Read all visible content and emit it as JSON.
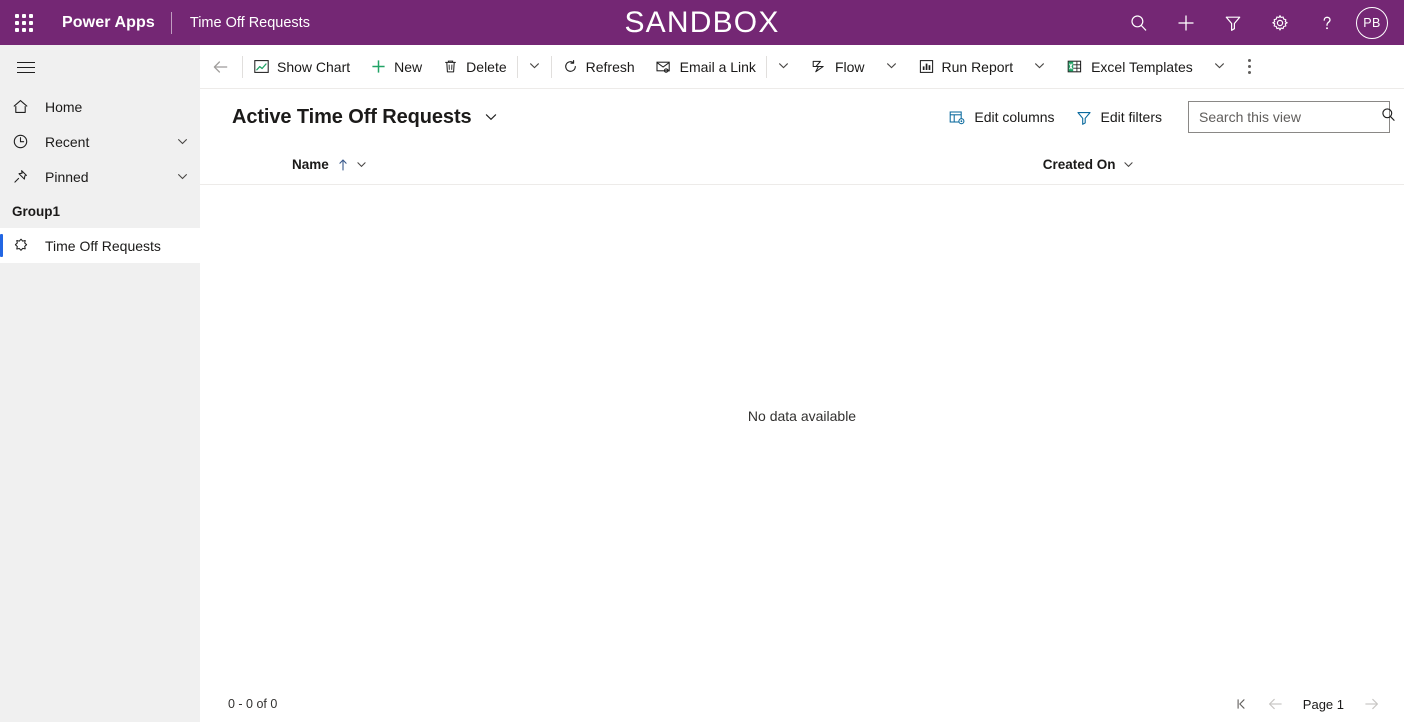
{
  "appbar": {
    "waffle_icon": "app-launcher-icon",
    "brand": "Power Apps",
    "app_name": "Time Off Requests",
    "environment": "SANDBOX",
    "actions": [
      {
        "name": "search-icon",
        "label": "Search"
      },
      {
        "name": "plus-icon",
        "label": "New"
      },
      {
        "name": "filter-icon",
        "label": "Filter"
      },
      {
        "name": "gear-icon",
        "label": "Settings"
      },
      {
        "name": "help-icon",
        "label": "Help"
      }
    ],
    "avatar_initials": "PB",
    "background_color": "#742774"
  },
  "sidebar": {
    "menu_icon": "hamburger-icon",
    "items": [
      {
        "label": "Home",
        "icon": "home-icon",
        "expandable": false,
        "selected": false
      },
      {
        "label": "Recent",
        "icon": "clock-icon",
        "expandable": true,
        "selected": false
      },
      {
        "label": "Pinned",
        "icon": "pin-icon",
        "expandable": true,
        "selected": false
      }
    ],
    "group_label": "Group1",
    "group_items": [
      {
        "label": "Time Off Requests",
        "icon": "entity-icon",
        "selected": true
      }
    ],
    "accent_color": "#2266e3",
    "background_color": "#f0f0f0"
  },
  "commandbar": {
    "back_label": "Back",
    "items": [
      {
        "label": "Show Chart",
        "icon": "show-chart-icon",
        "caret": false
      },
      {
        "label": "New",
        "icon": "plus-icon",
        "caret": false
      },
      {
        "label": "Delete",
        "icon": "trash-icon",
        "caret": true
      },
      {
        "label": "Refresh",
        "icon": "refresh-icon",
        "caret": false
      },
      {
        "label": "Email a Link",
        "icon": "email-link-icon",
        "caret": true
      },
      {
        "label": "Flow",
        "icon": "flow-icon",
        "caret": true
      },
      {
        "label": "Run Report",
        "icon": "report-icon",
        "caret": true
      },
      {
        "label": "Excel Templates",
        "icon": "excel-icon",
        "caret": true
      }
    ],
    "overflow_label": "More commands"
  },
  "view": {
    "title": "Active Time Off Requests",
    "edit_columns_label": "Edit columns",
    "edit_filters_label": "Edit filters",
    "search_placeholder": "Search this view",
    "search_value": ""
  },
  "grid": {
    "columns": [
      {
        "label": "Name",
        "sorted": "asc"
      },
      {
        "label": "Created On",
        "sorted": "none"
      }
    ],
    "rows": [],
    "empty_message": "No data available"
  },
  "footer": {
    "record_count": "0 - 0 of 0",
    "page_label": "Page 1",
    "first_page_label": "First page",
    "previous_page_label": "Previous page",
    "next_page_label": "Next page"
  }
}
